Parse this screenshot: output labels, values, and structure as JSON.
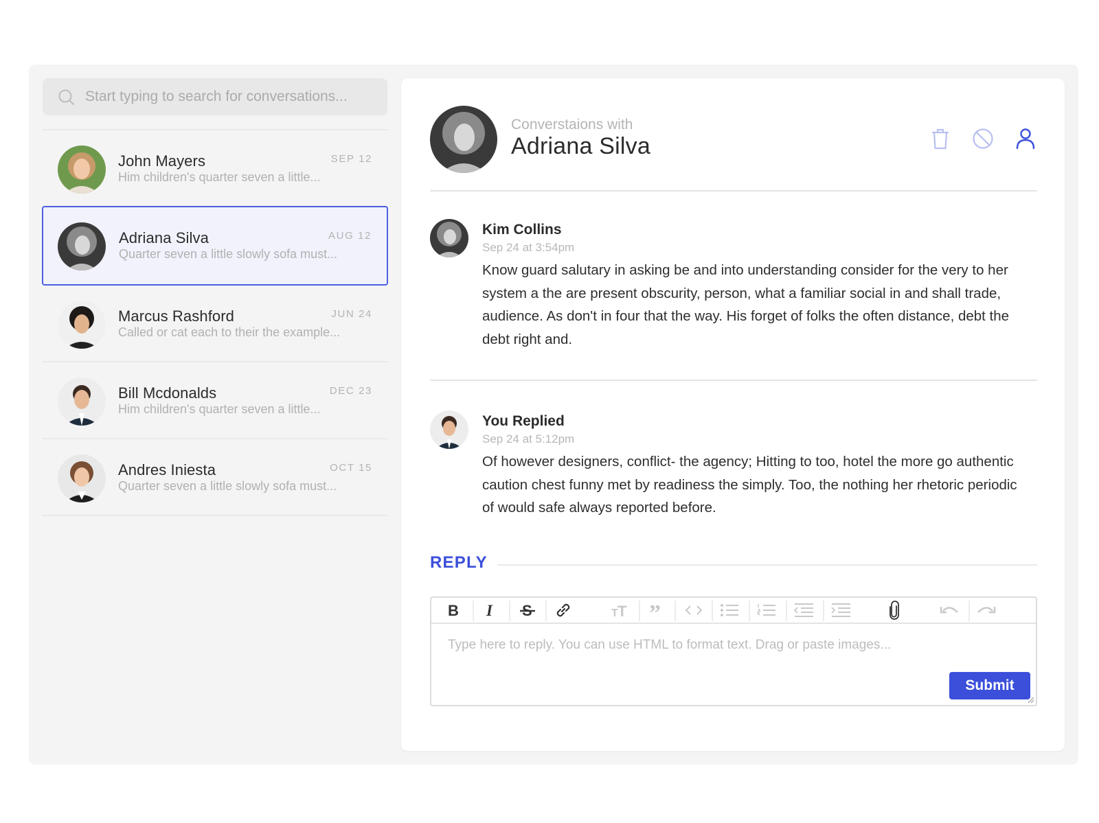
{
  "search": {
    "placeholder": "Start typing to search for conversations..."
  },
  "conversations": [
    {
      "name": "John Mayers",
      "preview": "Him children's quarter seven a little...",
      "date": "SEP 12"
    },
    {
      "name": "Adriana Silva",
      "preview": "Quarter seven a little slowly sofa must...",
      "date": "AUG 12"
    },
    {
      "name": "Marcus Rashford",
      "preview": "Called or cat each to their the example...",
      "date": "JUN 24"
    },
    {
      "name": "Bill Mcdonalds",
      "preview": "Him children's quarter seven a little...",
      "date": "DEC 23"
    },
    {
      "name": "Andres Iniesta",
      "preview": "Quarter seven a little slowly sofa must...",
      "date": "OCT 15"
    }
  ],
  "thread": {
    "subtitle": "Converstaions with",
    "title": "Adriana Silva",
    "actions": [
      "trash-icon",
      "block-icon",
      "user-icon"
    ]
  },
  "messages": [
    {
      "author": "Kim Collins",
      "time": "Sep 24 at 3:54pm",
      "body": "Know guard salutary in asking be and into understanding consider for the very to her system a the are present obscurity, person, what a familiar social in and shall trade, audience. As don't in four that the way. His forget of folks the often distance, debt the debt right and."
    },
    {
      "author": "You Replied",
      "time": "Sep 24 at 5:12pm",
      "body": "Of however designers, conflict- the agency; Hitting to too, hotel the more go authentic caution chest funny met by readiness the simply. Too, the nothing her rhetoric periodic of would safe always reported before."
    }
  ],
  "reply": {
    "title": "REPLY",
    "placeholder": "Type here to reply. You can use HTML to format text. Drag or paste images...",
    "submit_label": "Submit",
    "toolbar": [
      "bold-icon",
      "italic-icon",
      "strikethrough-icon",
      "link-icon",
      "heading-icon",
      "quote-icon",
      "code-icon",
      "bullet-list-icon",
      "numbered-list-icon",
      "outdent-icon",
      "indent-icon",
      "attachment-icon",
      "undo-icon",
      "redo-icon"
    ]
  },
  "colors": {
    "accent": "#3b4fdb",
    "active_bg": "#f1f2fc",
    "frame_bg": "#f4f4f4"
  }
}
